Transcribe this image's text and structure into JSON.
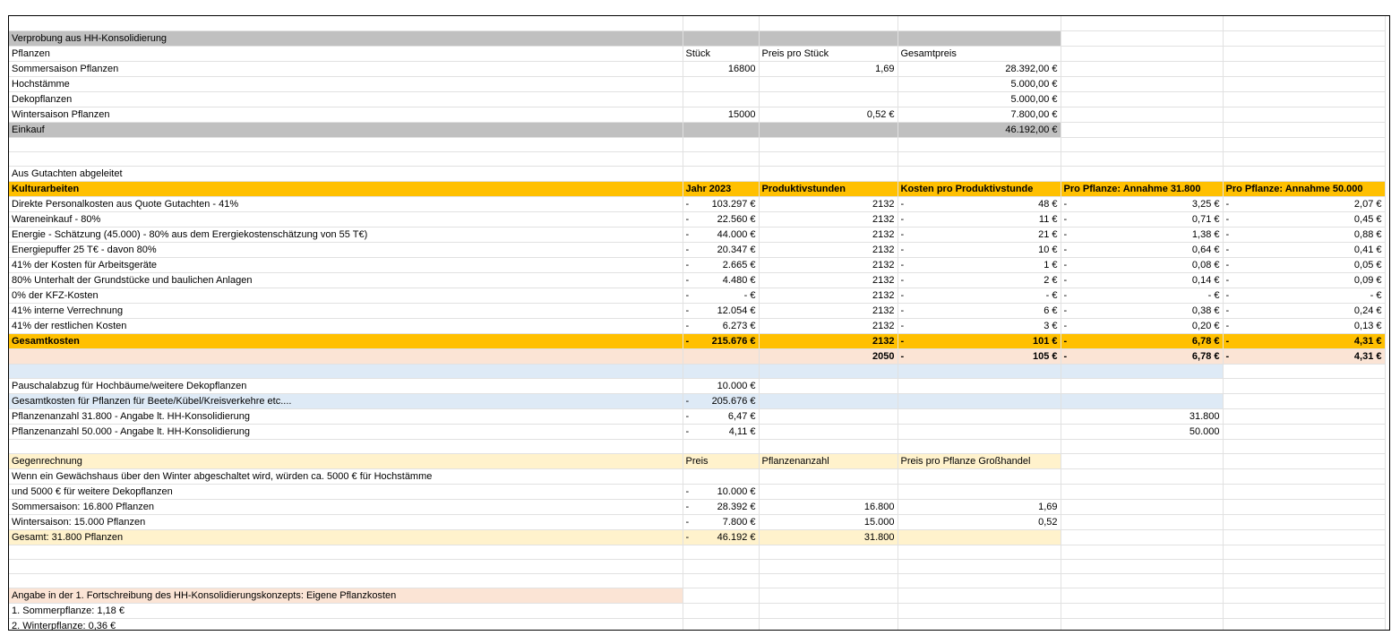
{
  "colors": {
    "gray": "#c0c0c0",
    "gold": "#ffc000",
    "peach": "#fbe4d5",
    "blue": "#deeaf6",
    "cream": "#fff2cc"
  },
  "s1": {
    "title": "Verprobung aus HH-Konsolidierung",
    "header": [
      "Pflanzen",
      "Stück",
      "Preis pro Stück",
      "Gesamtpreis"
    ],
    "rows": [
      [
        "Sommersaison Pflanzen",
        "16800",
        "1,69",
        "28.392,00 €"
      ],
      [
        "Hochstämme",
        "",
        "",
        "5.000,00 €"
      ],
      [
        "Dekopflanzen",
        "",
        "",
        "5.000,00 €"
      ],
      [
        "Wintersaison Pflanzen",
        "15000",
        "0,52 €",
        "7.800,00 €"
      ]
    ],
    "total_label": "Einkauf",
    "total_value": "46.192,00 €"
  },
  "s2": {
    "title": "Aus Gutachten abgeleitet",
    "header": [
      "Kulturarbeiten",
      "Jahr 2023",
      "Produktivstunden",
      "Kosten pro Produktivstunde",
      "Pro Pflanze: Annahme 31.800",
      "Pro Pflanze: Annahme 50.000"
    ],
    "rows": [
      [
        "Direkte Personalkosten aus Quote Gutachten - 41%",
        "103.297 €",
        "2132",
        "48 €",
        "3,25 €",
        "2,07 €"
      ],
      [
        "Wareneinkauf - 80%",
        "22.560 €",
        "2132",
        "11 €",
        "0,71 €",
        "0,45 €"
      ],
      [
        "Energie - Schätzung (45.000) - 80% aus dem Erergiekostenschätzung von 55 T€)",
        "44.000 €",
        "2132",
        "21 €",
        "1,38 €",
        "0,88 €"
      ],
      [
        "Energiepuffer 25 T€ - davon 80%",
        "20.347 €",
        "2132",
        "10 €",
        "0,64 €",
        "0,41 €"
      ],
      [
        "41% der Kosten für Arbeitsgeräte",
        "2.665 €",
        "2132",
        "1 €",
        "0,08 €",
        "0,05 €"
      ],
      [
        "80% Unterhalt der Grundstücke und baulichen Anlagen",
        "4.480 €",
        "2132",
        "2 €",
        "0,14 €",
        "0,09 €"
      ],
      [
        "0% der KFZ-Kosten",
        "-   €",
        "2132",
        "-   €",
        "-   €",
        "-   €"
      ],
      [
        "41% interne Verrechnung",
        "12.054 €",
        "2132",
        "6 €",
        "0,38 €",
        "0,24 €"
      ],
      [
        "41% der restlichen Kosten",
        "6.273 €",
        "2132",
        "3 €",
        "0,20 €",
        "0,13 €"
      ]
    ],
    "total": [
      "Gesamtkosten",
      "215.676 €",
      "2132",
      "101 €",
      "6,78 €",
      "4,31 €"
    ],
    "alt": [
      "",
      "",
      "2050",
      "105 €",
      "6,78 €",
      "4,31 €"
    ]
  },
  "s3": {
    "rows": [
      [
        "Pauschalabzug für Hochbäume/weitere Dekopflanzen",
        "10.000 €",
        ""
      ],
      [
        "Gesamtkosten für Pflanzen für Beete/Kübel/Kreisverkehre etc....",
        "205.676 €",
        ""
      ],
      [
        "Pflanzenanzahl 31.800 - Angabe lt. HH-Konsolidierung",
        "6,47 €",
        "31.800"
      ],
      [
        "Pflanzenanzahl 50.000 - Angabe lt. HH-Konsolidierung",
        "4,11 €",
        "50.000"
      ]
    ]
  },
  "s4": {
    "header": [
      "Gegenrechnung",
      "Preis",
      "Pflanzenanzahl",
      "Preis pro Pflanze Großhandel"
    ],
    "note1": "Wenn ein Gewächshaus über den Winter abgeschaltet wird, würden ca. 5000 € für Hochstämme",
    "note2": "und 5000 € für weitere Dekopflanzen",
    "note2_value": "10.000 €",
    "rows": [
      [
        "Sommersaison: 16.800 Pflanzen",
        "28.392 €",
        "16.800",
        "1,69"
      ],
      [
        "Wintersaison: 15.000 Pflanzen",
        "7.800 €",
        "15.000",
        "0,52"
      ]
    ],
    "total": [
      "Gesamt: 31.800 Pflanzen",
      "46.192 €",
      "31.800",
      ""
    ]
  },
  "s5": {
    "title": "Angabe in der 1. Fortschreibung des HH-Konsolidierungskonzepts: Eigene Pflanzkosten",
    "lines": [
      "1. Sommerpflanze: 1,18 €",
      "2. Winterpflanze: 0,36 €"
    ]
  },
  "dash": "-"
}
